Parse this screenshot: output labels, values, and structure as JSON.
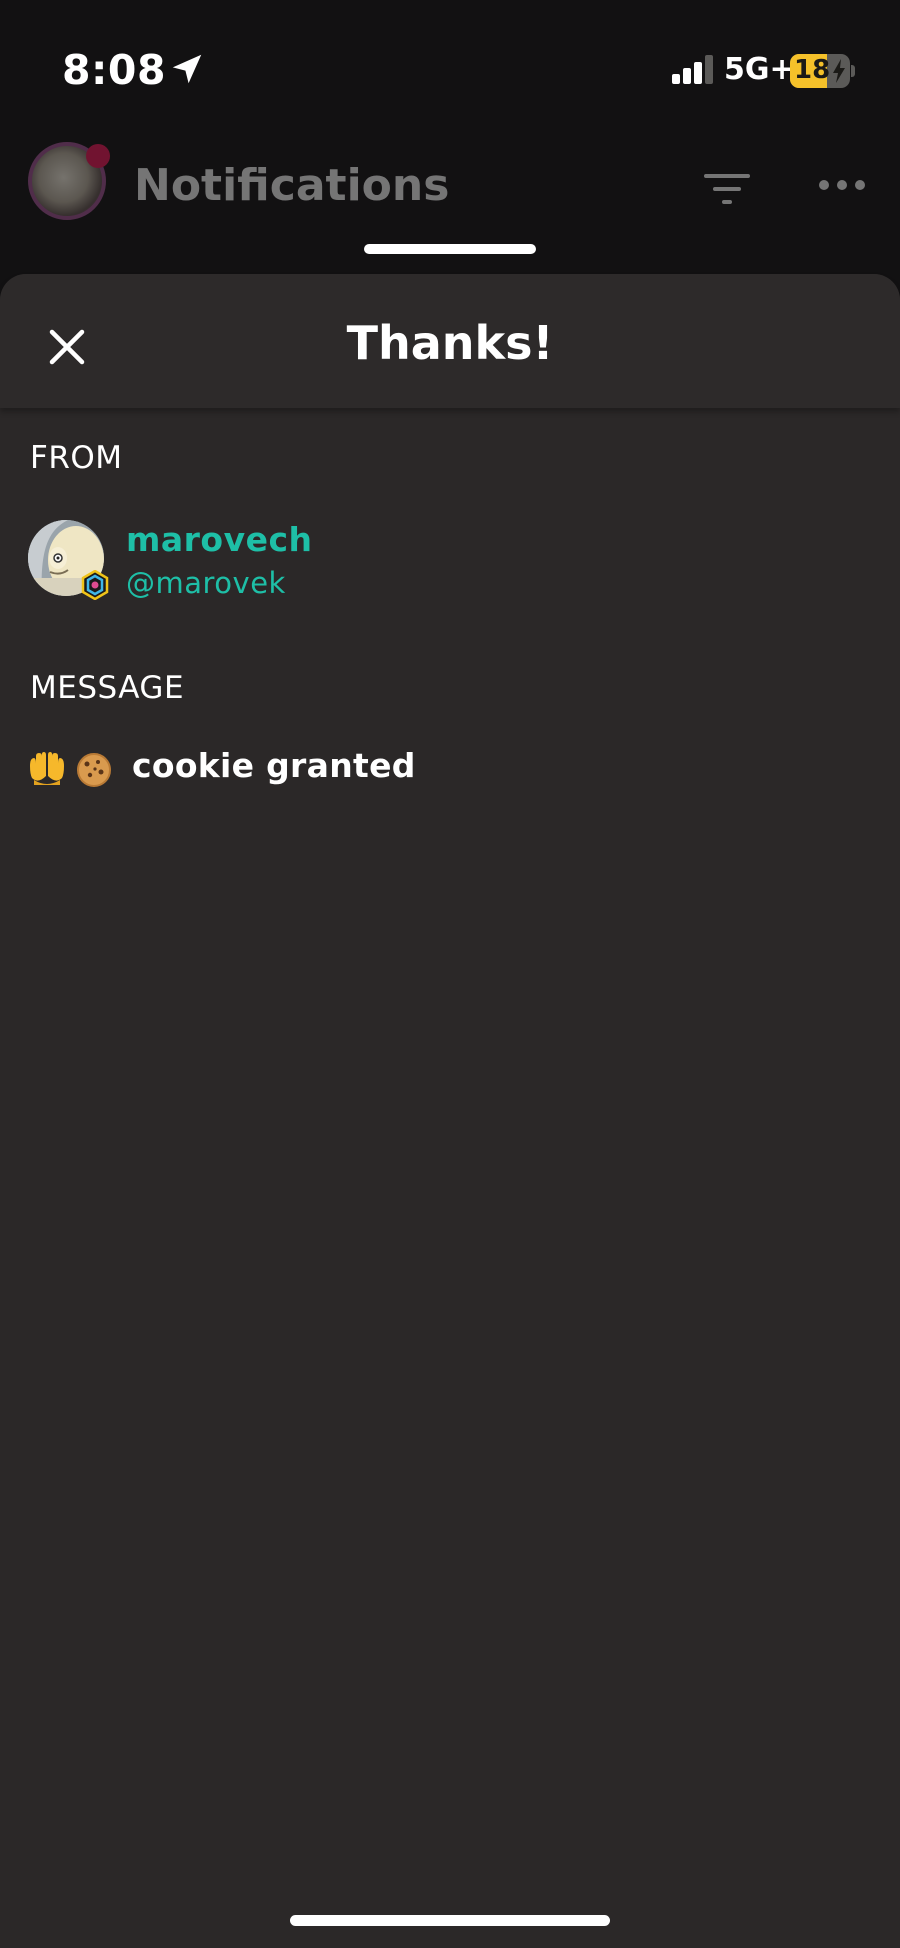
{
  "status_bar": {
    "time": "8:08",
    "network": "5G+",
    "battery_level": "18",
    "battery_fraction": 0.18,
    "icons": [
      "location-arrow-icon",
      "cellular-signal-icon",
      "battery-charging-icon"
    ]
  },
  "app_header": {
    "title": "Notifications",
    "icons": [
      "filter-icon",
      "more-icon"
    ]
  },
  "sheet": {
    "title": "Thanks!",
    "close_icon": "close-icon",
    "from_label": "FROM",
    "sender": {
      "display_name": "marovech",
      "handle": "@marovek"
    },
    "message_label": "MESSAGE",
    "message": {
      "emojis": [
        "palms-up-together-emoji",
        "cookie-emoji"
      ],
      "text": "cookie granted"
    }
  },
  "colors": {
    "background": "#121112",
    "sheet": "#2b2828",
    "accent": "#1ebfa7",
    "battery": "#f5c12a",
    "notification_dot": "#d0164f"
  }
}
